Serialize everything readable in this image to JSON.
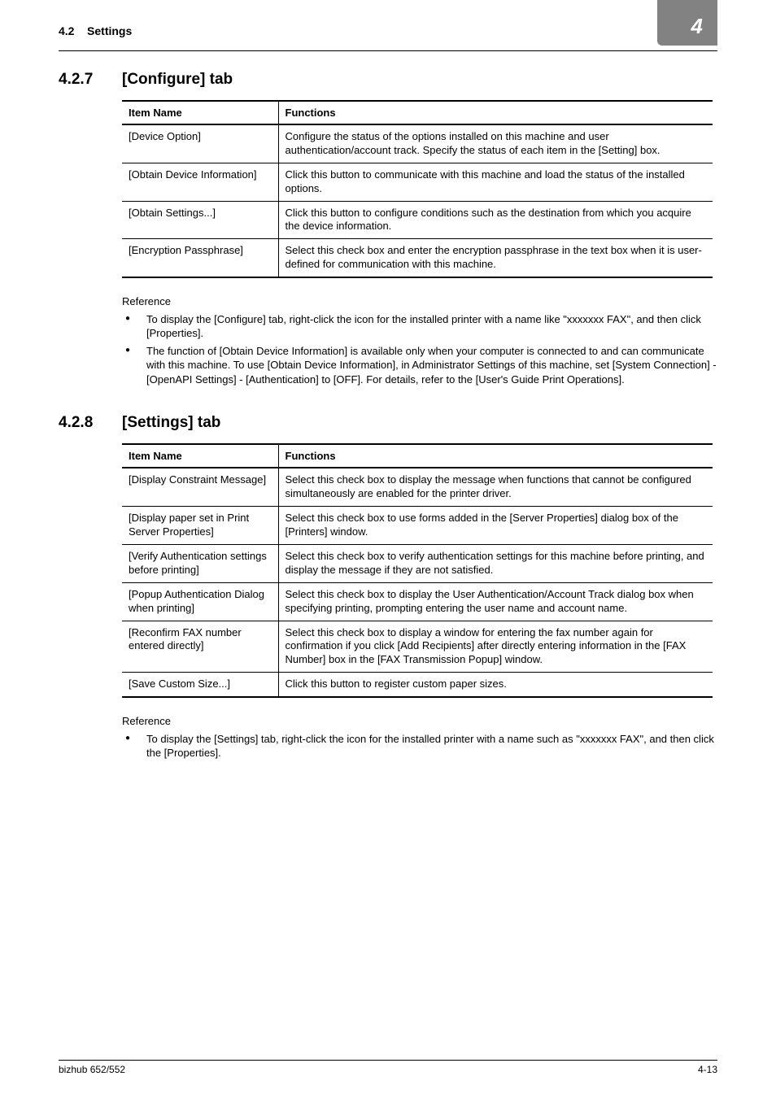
{
  "header": {
    "section_ref": "4.2",
    "section_label": "Settings",
    "chapter_number": "4"
  },
  "section1": {
    "number": "4.2.7",
    "title": "[Configure] tab",
    "table": {
      "col1": "Item Name",
      "col2": "Functions",
      "rows": [
        {
          "name": "[Device Option]",
          "func": "Configure the status of the options installed on this machine and user authentication/account track. Specify the status of each item in the [Setting] box."
        },
        {
          "name": "[Obtain Device Information]",
          "func": "Click this button to communicate with this machine and load the status of the installed options."
        },
        {
          "name": "[Obtain Settings...]",
          "func": "Click this button to configure conditions such as the destination from which you acquire the device information."
        },
        {
          "name": "[Encryption Passphrase]",
          "func": "Select this check box and enter the encryption passphrase in the text box when it is user-defined for communication with this machine."
        }
      ]
    },
    "reference_label": "Reference",
    "references": [
      "To display the [Configure] tab, right-click the icon for the installed printer with a name like \"xxxxxxx FAX\", and then click [Properties].",
      "The function of [Obtain Device Information] is available only when your computer is connected to and can communicate with this machine. To use [Obtain Device Information], in Administrator Settings of this machine, set [System Connection] - [OpenAPI Settings] - [Authentication] to [OFF]. For details, refer to the [User's Guide Print Operations]."
    ]
  },
  "section2": {
    "number": "4.2.8",
    "title": "[Settings] tab",
    "table": {
      "col1": "Item Name",
      "col2": "Functions",
      "rows": [
        {
          "name": "[Display Constraint Message]",
          "func": "Select this check box to display the message when functions that cannot be configured simultaneously are enabled for the printer driver."
        },
        {
          "name": "[Display paper set in Print Server Properties]",
          "func": "Select this check box to use forms added in the [Server Properties] dialog box of the [Printers] window."
        },
        {
          "name": "[Verify Authentication settings before printing]",
          "func": "Select this check box to verify authentication settings for this machine before printing, and display the message if they are not satisfied."
        },
        {
          "name": "[Popup Authentication Dialog when printing]",
          "func": "Select this check box to display the User Authentication/Account Track dialog box when specifying printing, prompting entering the user name and account name."
        },
        {
          "name": "[Reconfirm FAX number entered directly]",
          "func": "Select this check box to display a window for entering the fax number again for confirmation if you click [Add Recipients] after directly entering information in the [FAX Number] box in the [FAX Transmission Popup] window."
        },
        {
          "name": "[Save Custom Size...]",
          "func": "Click this button to register custom paper sizes."
        }
      ]
    },
    "reference_label": "Reference",
    "references": [
      "To display the [Settings] tab, right-click the icon for the installed printer with a name such as \"xxxxxxx FAX\", and then click the [Properties]."
    ]
  },
  "footer": {
    "left": "bizhub 652/552",
    "right": "4-13"
  }
}
